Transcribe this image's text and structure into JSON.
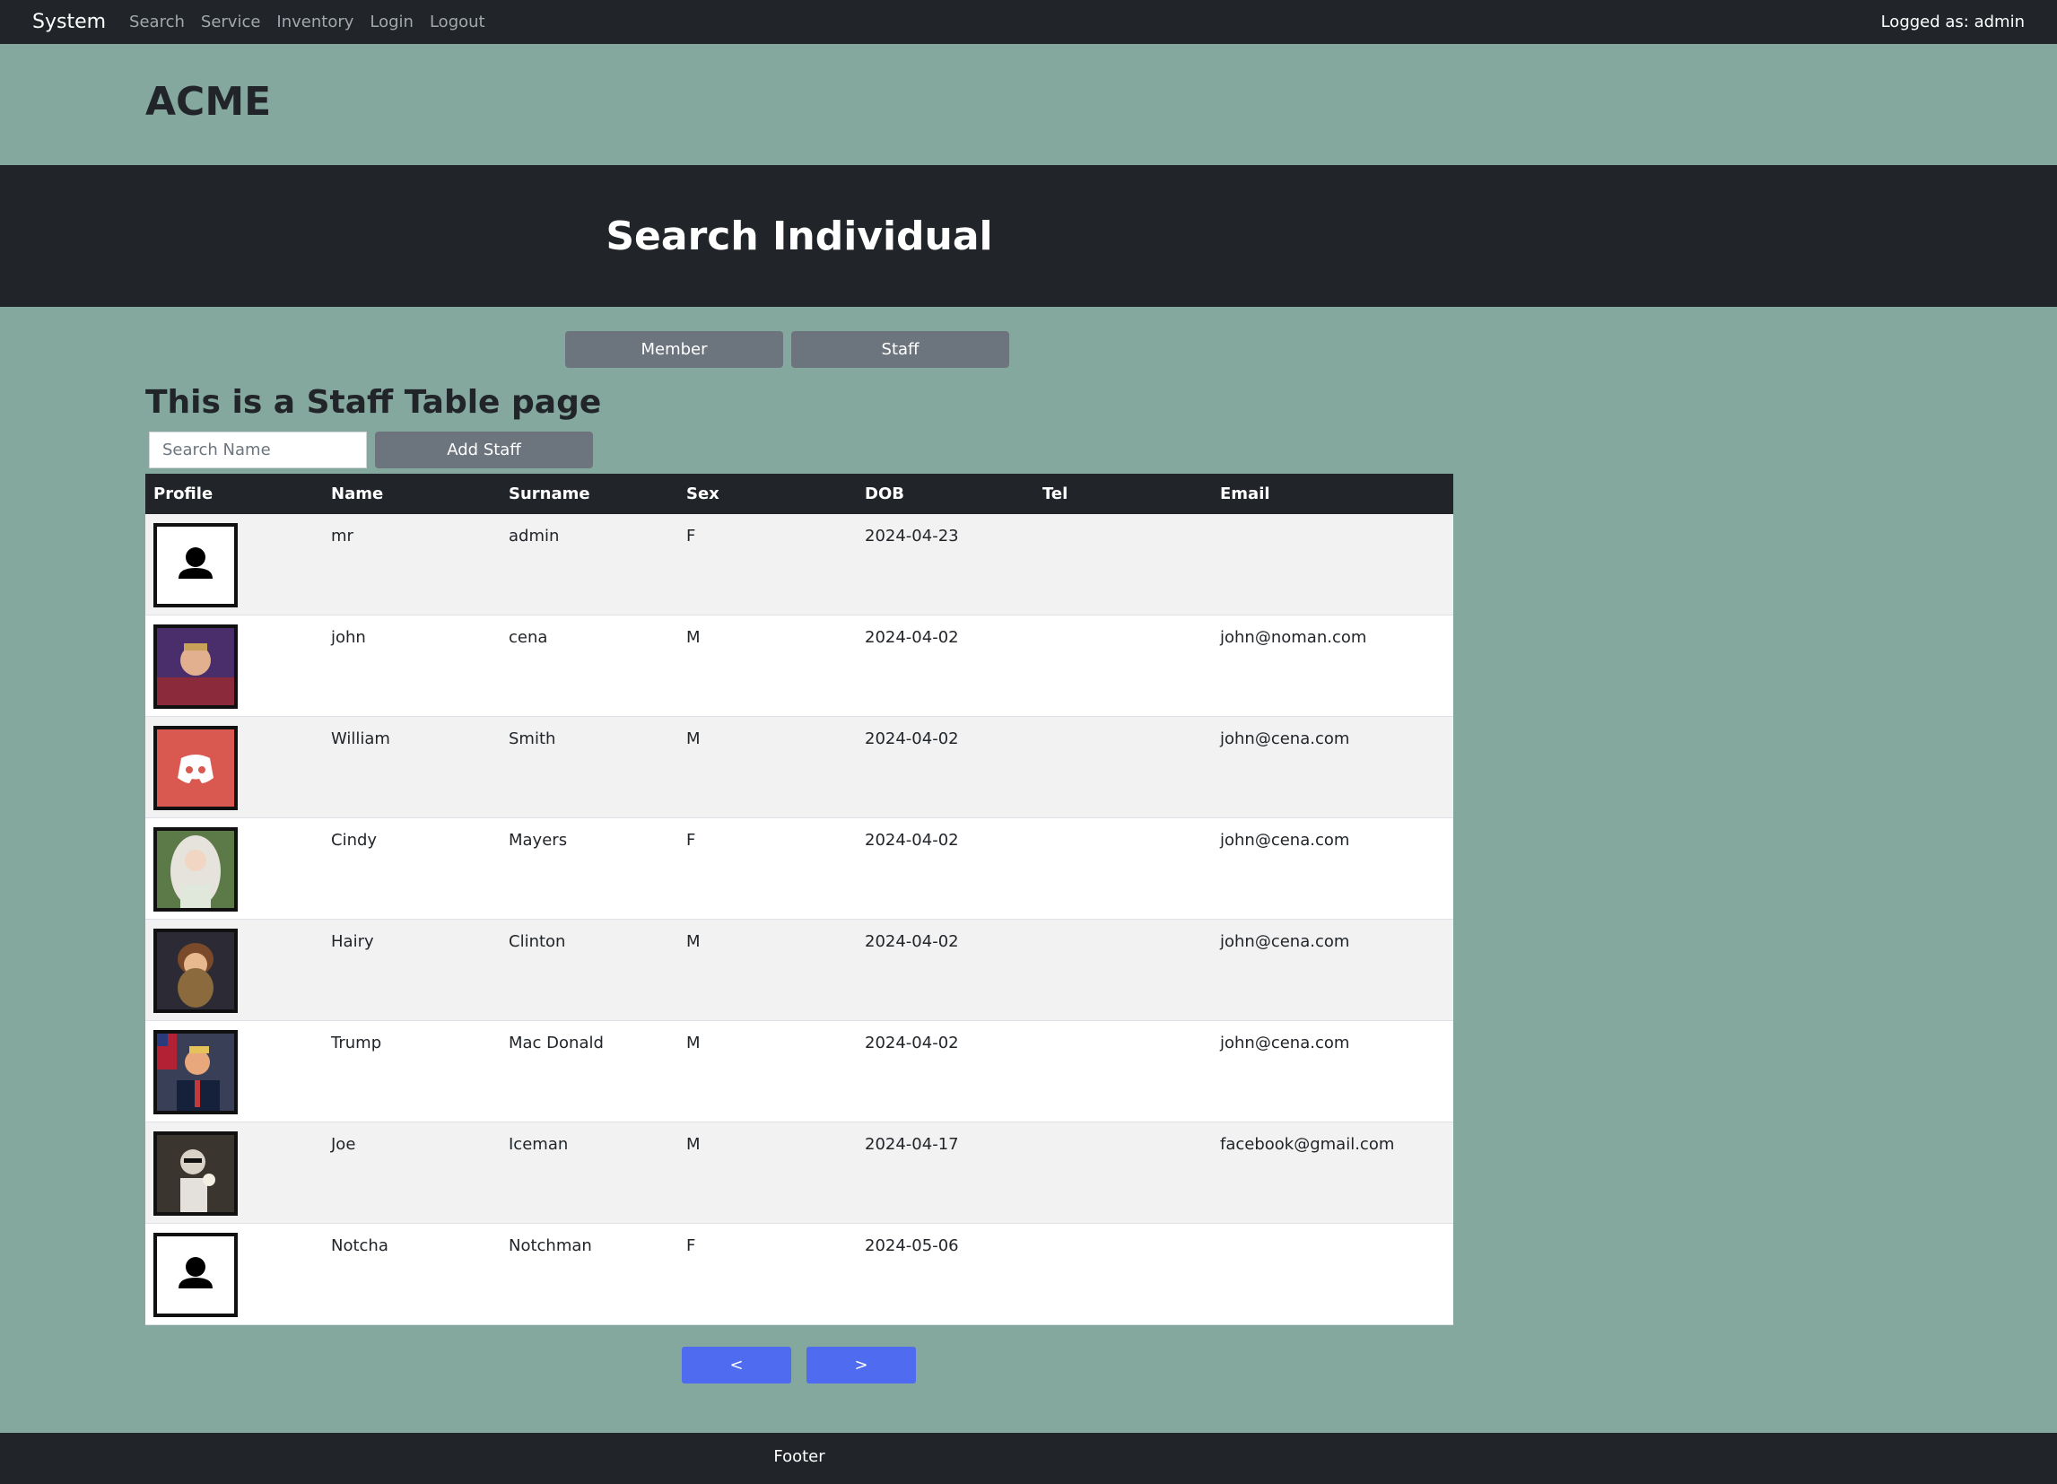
{
  "nav": {
    "brand": "System",
    "links": [
      "Search",
      "Service",
      "Inventory",
      "Login",
      "Logout"
    ],
    "logged": "Logged as: admin"
  },
  "company": "ACME",
  "hero_title": "Search Individual",
  "toggles": {
    "member": "Member",
    "staff": "Staff"
  },
  "section_title": "This is a Staff Table page",
  "search": {
    "placeholder": "Search Name"
  },
  "add_staff": "Add Staff",
  "table": {
    "headers": [
      "Profile",
      "Name",
      "Surname",
      "Sex",
      "DOB",
      "Tel",
      "Email"
    ],
    "rows": [
      {
        "avatar": "person-placeholder-icon",
        "name": "mr",
        "surname": "admin",
        "sex": "F",
        "dob": "2024-04-23",
        "tel": "",
        "email": ""
      },
      {
        "avatar": "photo-boy",
        "name": "john",
        "surname": "cena",
        "sex": "M",
        "dob": "2024-04-02",
        "tel": "",
        "email": "john@noman.com"
      },
      {
        "avatar": "discord-icon",
        "name": "William",
        "surname": "Smith",
        "sex": "M",
        "dob": "2024-04-02",
        "tel": "",
        "email": "john@cena.com"
      },
      {
        "avatar": "photo-woman",
        "name": "Cindy",
        "surname": "Mayers",
        "sex": "F",
        "dob": "2024-04-02",
        "tel": "",
        "email": "john@cena.com"
      },
      {
        "avatar": "photo-bearded",
        "name": "Hairy",
        "surname": "Clinton",
        "sex": "M",
        "dob": "2024-04-02",
        "tel": "",
        "email": "john@cena.com"
      },
      {
        "avatar": "photo-suit",
        "name": "Trump",
        "surname": "Mac Donald",
        "sex": "M",
        "dob": "2024-04-02",
        "tel": "",
        "email": "john@cena.com"
      },
      {
        "avatar": "photo-man",
        "name": "Joe",
        "surname": "Iceman",
        "sex": "M",
        "dob": "2024-04-17",
        "tel": "",
        "email": "facebook@gmail.com"
      },
      {
        "avatar": "person-placeholder-icon",
        "name": "Notcha",
        "surname": "Notchman",
        "sex": "F",
        "dob": "2024-05-06",
        "tel": "",
        "email": ""
      }
    ]
  },
  "pager": {
    "prev": "<",
    "next": ">"
  },
  "footer": "Footer",
  "colors": {
    "background": "#84a89e",
    "dark": "#212529",
    "button_gray": "#6c757d",
    "pager_blue": "#4f6bf0",
    "discord_red": "#d9584f"
  }
}
